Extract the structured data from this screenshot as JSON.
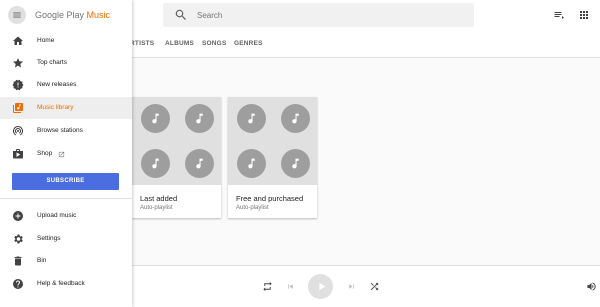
{
  "app": {
    "logo_prefix": "Google Play",
    "logo_suffix": "Music"
  },
  "search": {
    "placeholder": "Search"
  },
  "subnav": {
    "tabs": [
      {
        "label": "RTISTS"
      },
      {
        "label": "ALBUMS"
      },
      {
        "label": "SONGS"
      },
      {
        "label": "GENRES"
      }
    ]
  },
  "sidebar": {
    "items": [
      {
        "label": "Home",
        "icon": "home-icon"
      },
      {
        "label": "Top charts",
        "icon": "star-icon"
      },
      {
        "label": "New releases",
        "icon": "new-releases-icon"
      },
      {
        "label": "Music library",
        "icon": "music-library-icon",
        "active": true
      },
      {
        "label": "Browse stations",
        "icon": "radio-icon"
      },
      {
        "label": "Shop",
        "icon": "shop-icon"
      }
    ],
    "subscribe_label": "SUBSCRIBE",
    "secondary_items": [
      {
        "label": "Upload music",
        "icon": "upload-icon"
      },
      {
        "label": "Settings",
        "icon": "gear-icon"
      },
      {
        "label": "Bin",
        "icon": "trash-icon"
      },
      {
        "label": "Help & feedback",
        "icon": "help-icon"
      }
    ]
  },
  "playlists": [
    {
      "title": "Last added",
      "subtitle": "Auto-playlist"
    },
    {
      "title": "Free and purchased",
      "subtitle": "Auto-playlist"
    }
  ],
  "colors": {
    "accent": "#ef6c00",
    "subscribe": "#4a6ee0",
    "art_bg": "#e0e0e0",
    "disc": "#9e9e9e"
  }
}
